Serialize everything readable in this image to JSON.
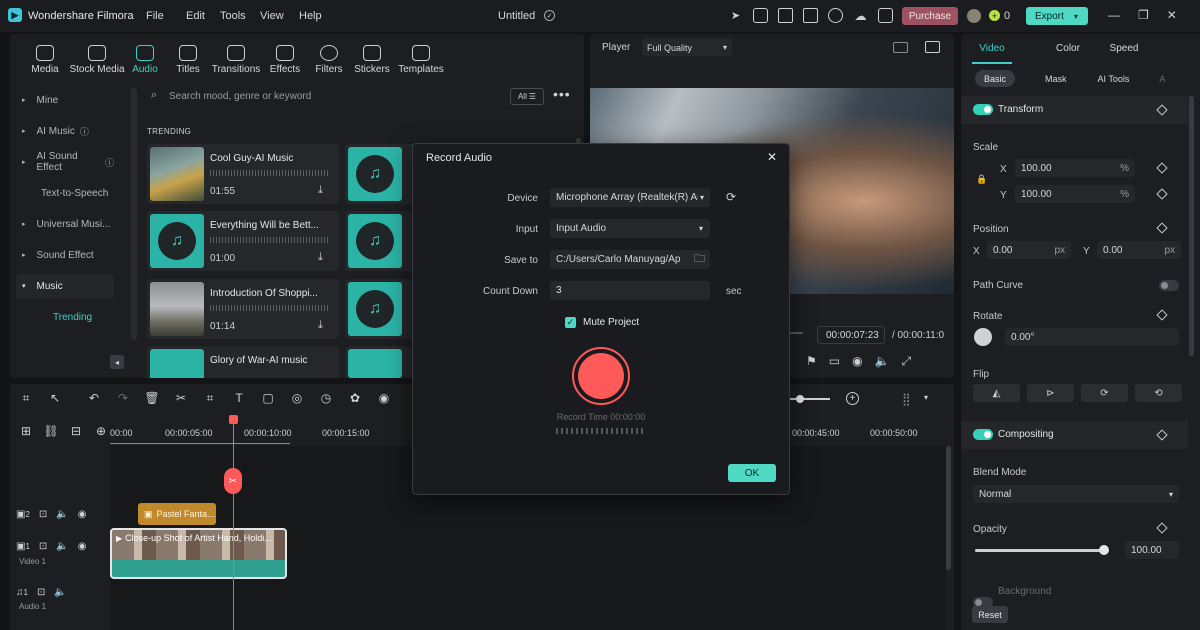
{
  "app": {
    "name": "Wondershare Filmora",
    "project": "Untitled"
  },
  "menu": [
    "File",
    "Edit",
    "Tools",
    "View",
    "Help"
  ],
  "header": {
    "purchase": "Purchase",
    "credits": "0",
    "export": "Export"
  },
  "media_tabs": [
    "Media",
    "Stock Media",
    "Audio",
    "Titles",
    "Transitions",
    "Effects",
    "Filters",
    "Stickers",
    "Templates"
  ],
  "active_media_tab": "Audio",
  "sidebar": [
    "Mine",
    "AI Music",
    "AI Sound Effect",
    "Text-to-Speech",
    "Universal Musi...",
    "Sound Effect",
    "Music",
    "Trending"
  ],
  "search": {
    "placeholder": "Search mood, genre or keyword",
    "filter": "All"
  },
  "trending_label": "TRENDING",
  "tracks": [
    {
      "title": "Cool Guy-AI Music",
      "duration": "01:55"
    },
    {
      "title": "Everything Will be Bett...",
      "duration": "01:00"
    },
    {
      "title": "Introduction Of Shoppi...",
      "duration": "01:14"
    },
    {
      "title": "Glory of War-AI music",
      "duration": ""
    }
  ],
  "player": {
    "label": "Player",
    "quality": "Full Quality",
    "current_time": "00:00:07:23",
    "total_time": "/ 00:00:11:0"
  },
  "dialog": {
    "title": "Record Audio",
    "device_label": "Device",
    "device_value": "Microphone Array (Realtek(R) Aud",
    "input_label": "Input",
    "input_value": "Input Audio",
    "saveto_label": "Save to",
    "saveto_value": "C:/Users/Carlo Manuyag/Ap",
    "countdown_label": "Count Down",
    "countdown_value": "3",
    "countdown_unit": "sec",
    "mute_label": "Mute Project",
    "record_time": "Record Time 00:00:00",
    "ok": "OK"
  },
  "right_panel": {
    "tabs": [
      "Video",
      "Color",
      "Speed"
    ],
    "subtabs": [
      "Basic",
      "Mask",
      "AI Tools",
      "A"
    ],
    "transform": "Transform",
    "scale": "Scale",
    "x_label": "X",
    "y_label": "Y",
    "scale_x": "100.00",
    "scale_y": "100.00",
    "pct": "%",
    "position": "Position",
    "pos_x": "0.00",
    "pos_y": "0.00",
    "px": "px",
    "path_curve": "Path Curve",
    "rotate": "Rotate",
    "rotate_value": "0.00°",
    "flip": "Flip",
    "compositing": "Compositing",
    "blend_mode": "Blend Mode",
    "blend_value": "Normal",
    "opacity": "Opacity",
    "opacity_value": "100.00",
    "background": "Background",
    "reset": "Reset"
  },
  "timeline": {
    "ruler": [
      "00:00",
      "00:00:05:00",
      "00:00:10:00",
      "00:00:15:00",
      "00:00:45:00",
      "00:00:50:00"
    ],
    "text_clip": "Pastel Fanta...",
    "video_clip": "Close-up Shot of Artist Hand, Holdi...",
    "track_video": "Video 1",
    "track_audio": "Audio 1",
    "track_nums": [
      "2",
      "1",
      "1"
    ]
  },
  "colors": {
    "accent": "#34d1b8",
    "record": "#ff5a5a",
    "purchase": "#b25b6b",
    "playhead": "#ff5a5a"
  }
}
